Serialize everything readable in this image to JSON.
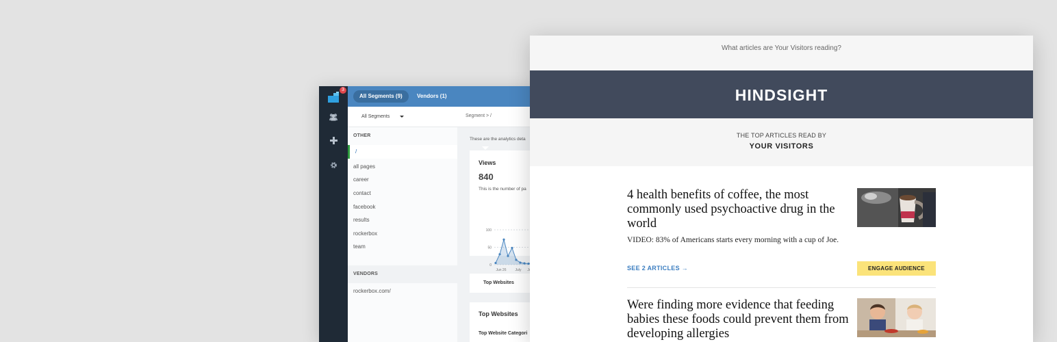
{
  "dashboard": {
    "badge_count": "3",
    "tabs": [
      {
        "label": "All Segments (9)",
        "active": true
      },
      {
        "label": "Vendors (1)",
        "active": false
      }
    ],
    "segment_select": "All Segments",
    "breadcrumb": "Segment > /",
    "other_heading": "OTHER",
    "active_segment": "/",
    "segments": [
      "all pages",
      "career",
      "contact",
      "facebook",
      "results",
      "rockerbox",
      "team"
    ],
    "vendors_heading": "VENDORS",
    "vendors": [
      "rockerbox.com/"
    ],
    "description": "These are the analytics deta",
    "views": {
      "title": "Views",
      "value": "840",
      "description": "This is the number of pa"
    },
    "top_websites_tab": "Top Websites",
    "top_websites_card": {
      "title": "Top Websites",
      "subtitle": "Top Website Categori"
    },
    "rail_icons": [
      "users-icon",
      "plus-icon",
      "gear-icon"
    ]
  },
  "chart_data": {
    "type": "area",
    "x_ticks": [
      "Jun 26",
      "July",
      "Ju"
    ],
    "y_ticks": [
      "100",
      "50",
      "0"
    ],
    "ylim": [
      0,
      100
    ],
    "values": [
      5,
      30,
      72,
      25,
      48,
      14,
      6,
      4,
      3,
      5,
      7
    ],
    "color": "#4a86c0"
  },
  "email": {
    "preheader": "What articles are Your Visitors reading?",
    "brand": "HINDSIGHT",
    "subhead_line1": "THE TOP ARTICLES READ BY",
    "subhead_line2": "YOUR VISITORS",
    "articles": [
      {
        "title": "4 health benefits of coffee, the most commonly used psychoactive drug in the world",
        "subtitle": "VIDEO: 83% of Americans starts every morning with a cup of Joe.",
        "link": "SEE 2 ARTICLES →",
        "button": "ENGAGE AUDIENCE"
      },
      {
        "title": "Were finding more evidence that feeding babies these foods could prevent them from developing allergies"
      }
    ],
    "colors": {
      "masthead": "#414a5c",
      "link": "#3a7dc0",
      "button": "#fbe37a"
    }
  }
}
